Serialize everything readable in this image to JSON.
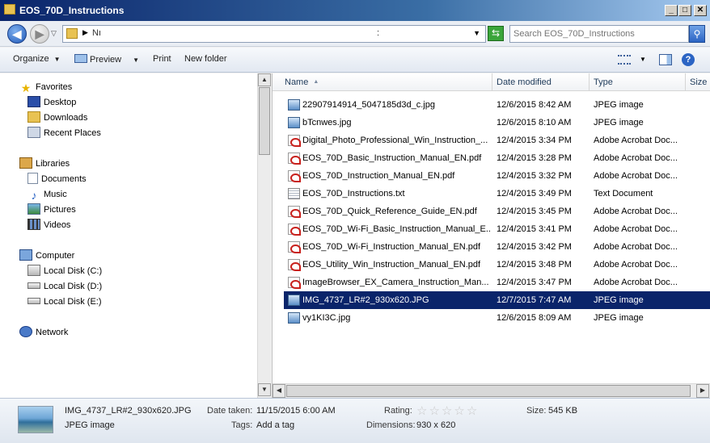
{
  "window": {
    "title": "EOS_70D_Instructions",
    "controls": {
      "minimize": "_",
      "maximize": "□",
      "close": "✕"
    }
  },
  "address": {
    "path_fragment": "Nı",
    "separator": ":",
    "search_placeholder": "Search EOS_70D_Instructions"
  },
  "toolbar": {
    "organize": "Organize",
    "preview": "Preview",
    "print": "Print",
    "new_folder": "New folder"
  },
  "nav": {
    "favorites": {
      "label": "Favorites",
      "items": [
        "Desktop",
        "Downloads",
        "Recent Places"
      ]
    },
    "libraries": {
      "label": "Libraries",
      "items": [
        "Documents",
        "Music",
        "Pictures",
        "Videos"
      ]
    },
    "computer": {
      "label": "Computer",
      "items": [
        "Local Disk (C:)",
        "Local Disk (D:)",
        "Local Disk (E:)"
      ]
    },
    "network": {
      "label": "Network"
    }
  },
  "columns": {
    "name": "Name",
    "date": "Date modified",
    "type": "Type",
    "size": "Size"
  },
  "files": [
    {
      "name": "22907914914_5047185d3d_c.jpg",
      "date": "12/6/2015 8:42 AM",
      "type": "JPEG image",
      "kind": "jpg"
    },
    {
      "name": "bTcnwes.jpg",
      "date": "12/6/2015 8:10 AM",
      "type": "JPEG image",
      "kind": "jpg"
    },
    {
      "name": "Digital_Photo_Professional_Win_Instruction_...",
      "date": "12/4/2015 3:34 PM",
      "type": "Adobe Acrobat Doc...",
      "kind": "pdf"
    },
    {
      "name": "EOS_70D_Basic_Instruction_Manual_EN.pdf",
      "date": "12/4/2015 3:28 PM",
      "type": "Adobe Acrobat Doc...",
      "kind": "pdf"
    },
    {
      "name": "EOS_70D_Instruction_Manual_EN.pdf",
      "date": "12/4/2015 3:32 PM",
      "type": "Adobe Acrobat Doc...",
      "kind": "pdf"
    },
    {
      "name": "EOS_70D_Instructions.txt",
      "date": "12/4/2015 3:49 PM",
      "type": "Text Document",
      "kind": "txt"
    },
    {
      "name": "EOS_70D_Quick_Reference_Guide_EN.pdf",
      "date": "12/4/2015 3:45 PM",
      "type": "Adobe Acrobat Doc...",
      "kind": "pdf"
    },
    {
      "name": "EOS_70D_Wi-Fi_Basic_Instruction_Manual_E...",
      "date": "12/4/2015 3:41 PM",
      "type": "Adobe Acrobat Doc...",
      "kind": "pdf"
    },
    {
      "name": "EOS_70D_Wi-Fi_Instruction_Manual_EN.pdf",
      "date": "12/4/2015 3:42 PM",
      "type": "Adobe Acrobat Doc...",
      "kind": "pdf"
    },
    {
      "name": "EOS_Utility_Win_Instruction_Manual_EN.pdf",
      "date": "12/4/2015 3:48 PM",
      "type": "Adobe Acrobat Doc...",
      "kind": "pdf"
    },
    {
      "name": "ImageBrowser_EX_Camera_Instruction_Man...",
      "date": "12/4/2015 3:47 PM",
      "type": "Adobe Acrobat Doc...",
      "kind": "pdf"
    },
    {
      "name": "IMG_4737_LR#2_930x620.JPG",
      "date": "12/7/2015 7:47 AM",
      "type": "JPEG image",
      "kind": "jpg",
      "selected": true
    },
    {
      "name": "vy1KI3C.jpg",
      "date": "12/6/2015 8:09 AM",
      "type": "JPEG image",
      "kind": "jpg"
    }
  ],
  "details": {
    "filename": "IMG_4737_LR#2_930x620.JPG",
    "filetype": "JPEG image",
    "date_label": "Date taken:",
    "date_value": "11/15/2015 6:00 AM",
    "tags_label": "Tags:",
    "tags_value": "Add a tag",
    "rating_label": "Rating:",
    "rating_stars": 0,
    "dimensions_label": "Dimensions:",
    "dimensions_value": "930 x 620",
    "size_label": "Size:",
    "size_value": "545 KB"
  },
  "colors": {
    "selection": "#0a246a",
    "title_gradient_start": "#0a246a"
  }
}
